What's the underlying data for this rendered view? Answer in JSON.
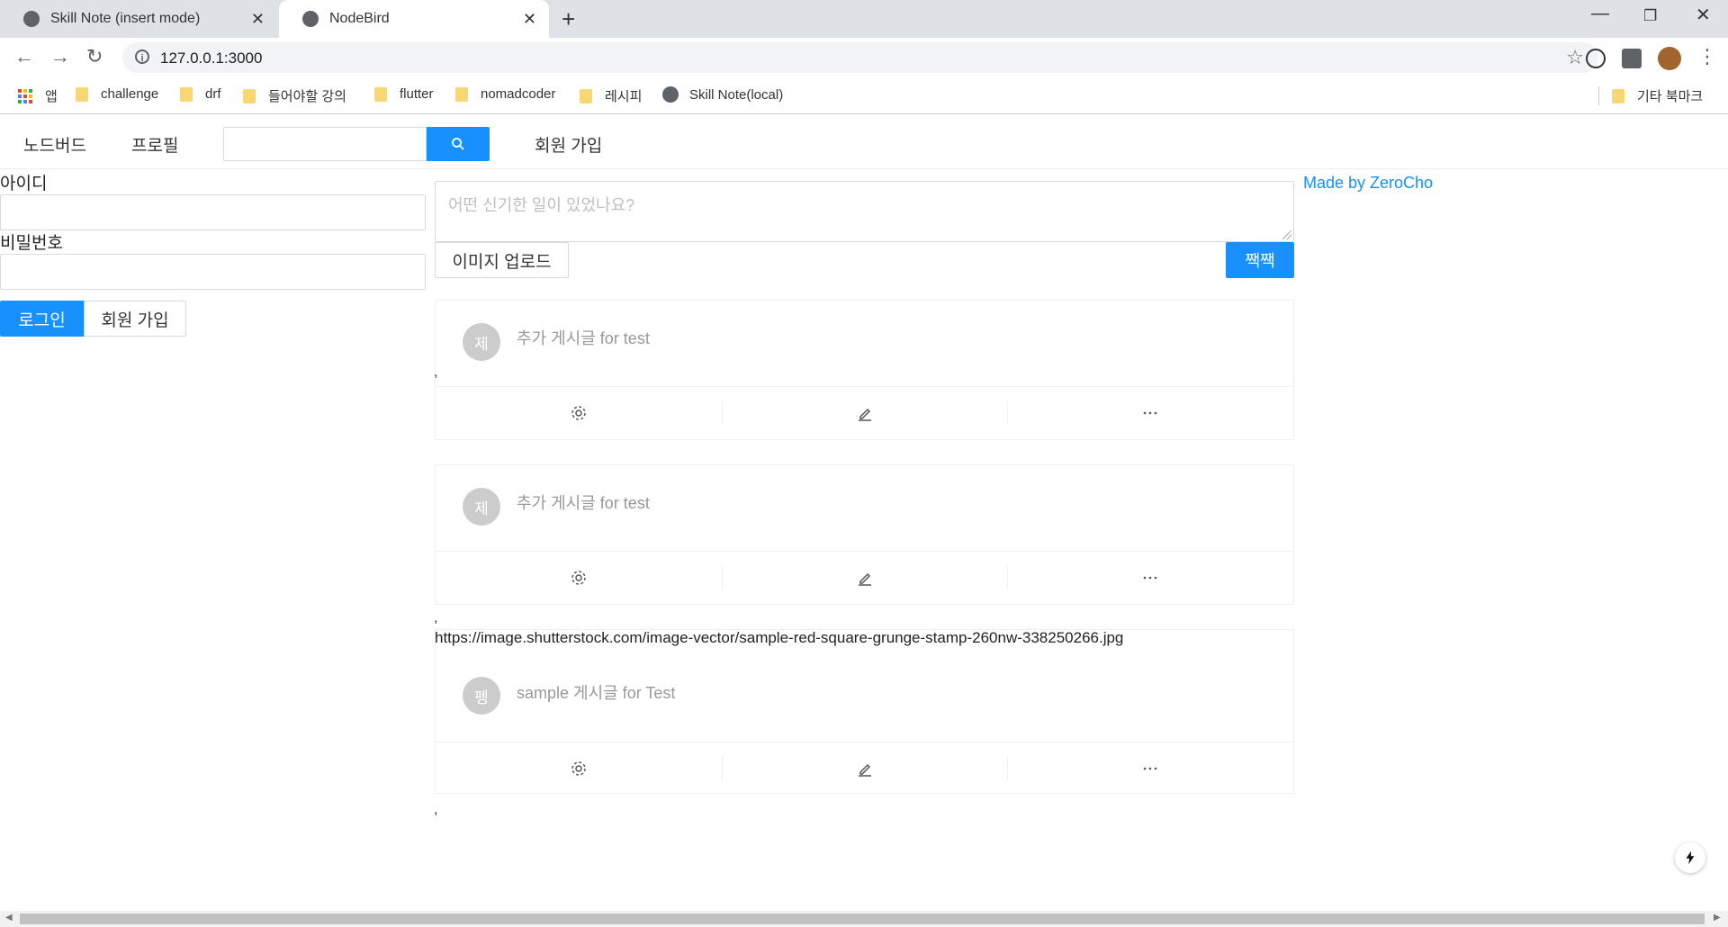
{
  "browser": {
    "tabs": [
      {
        "title": "Skill Note (insert mode)"
      },
      {
        "title": "NodeBird"
      }
    ],
    "url": "127.0.0.1:3000",
    "bookmarks": [
      "앱",
      "challenge",
      "drf",
      "들어야할 강의",
      "flutter",
      "nomadcoder",
      "레시피",
      "Skill Note(local)"
    ],
    "other_bookmarks": "기타 북마크"
  },
  "nav": {
    "home": "노드버드",
    "profile": "프로필",
    "signup": "회원 가입"
  },
  "login": {
    "id_label": "아이디",
    "pw_label": "비밀번호",
    "login_button": "로그인",
    "signup_button": "회원 가입"
  },
  "composer": {
    "placeholder": "어떤 신기한 일이 있었나요?",
    "upload_button": "이미지 업로드",
    "submit_button": "짹짹"
  },
  "posts": [
    {
      "avatar": "제",
      "content": "추가 게시글 for test"
    },
    {
      "avatar": "제",
      "content": "추가 게시글 for test"
    },
    {
      "image_url": "https://image.shutterstock.com/image-vector/sample-red-square-grunge-stamp-260nw-338250266.jpg",
      "avatar": "펭",
      "content": "sample 게시글 for Test"
    }
  ],
  "separator": ",",
  "made_by": "Made by ZeroCho",
  "colors": {
    "primary": "#1890ff"
  }
}
